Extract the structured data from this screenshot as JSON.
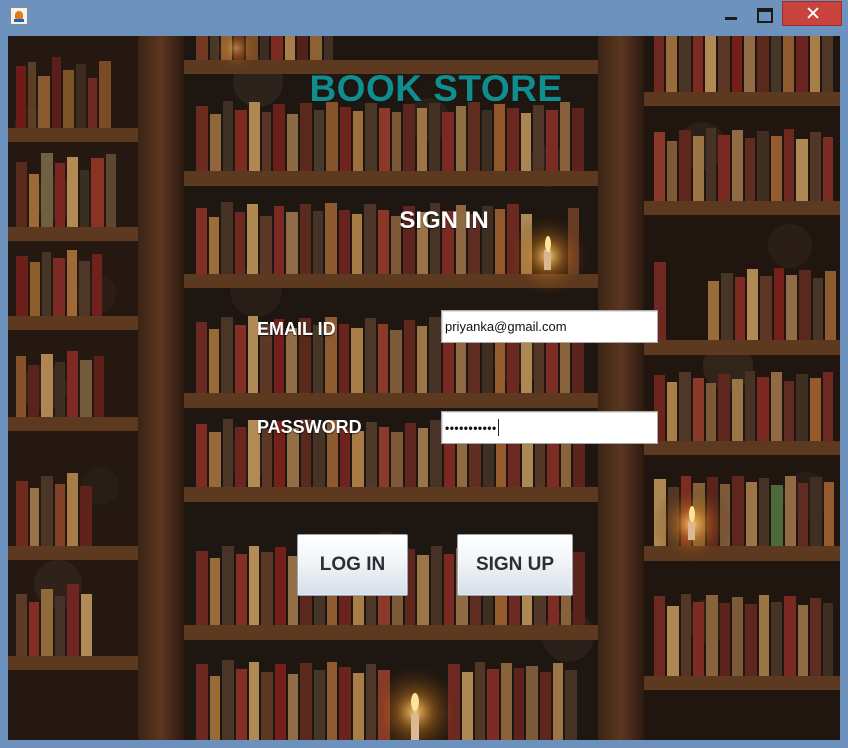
{
  "window": {
    "accent": "#6d92be",
    "close_color": "#c9433d"
  },
  "app": {
    "title": "BOOK STORE",
    "subtitle": "SIGN IN",
    "title_color": "#0f8d8f"
  },
  "form": {
    "email_label": "EMAIL ID",
    "email_value": "priyanka@gmail.com",
    "password_label": "PASSWORD",
    "password_value": "•••••••••••"
  },
  "buttons": {
    "login_label": "LOG IN",
    "signup_label": "SIGN UP"
  },
  "icons": {
    "app": "java-app-icon",
    "minimize": "minimize-icon",
    "maximize": "maximize-icon",
    "close": "close-icon"
  }
}
